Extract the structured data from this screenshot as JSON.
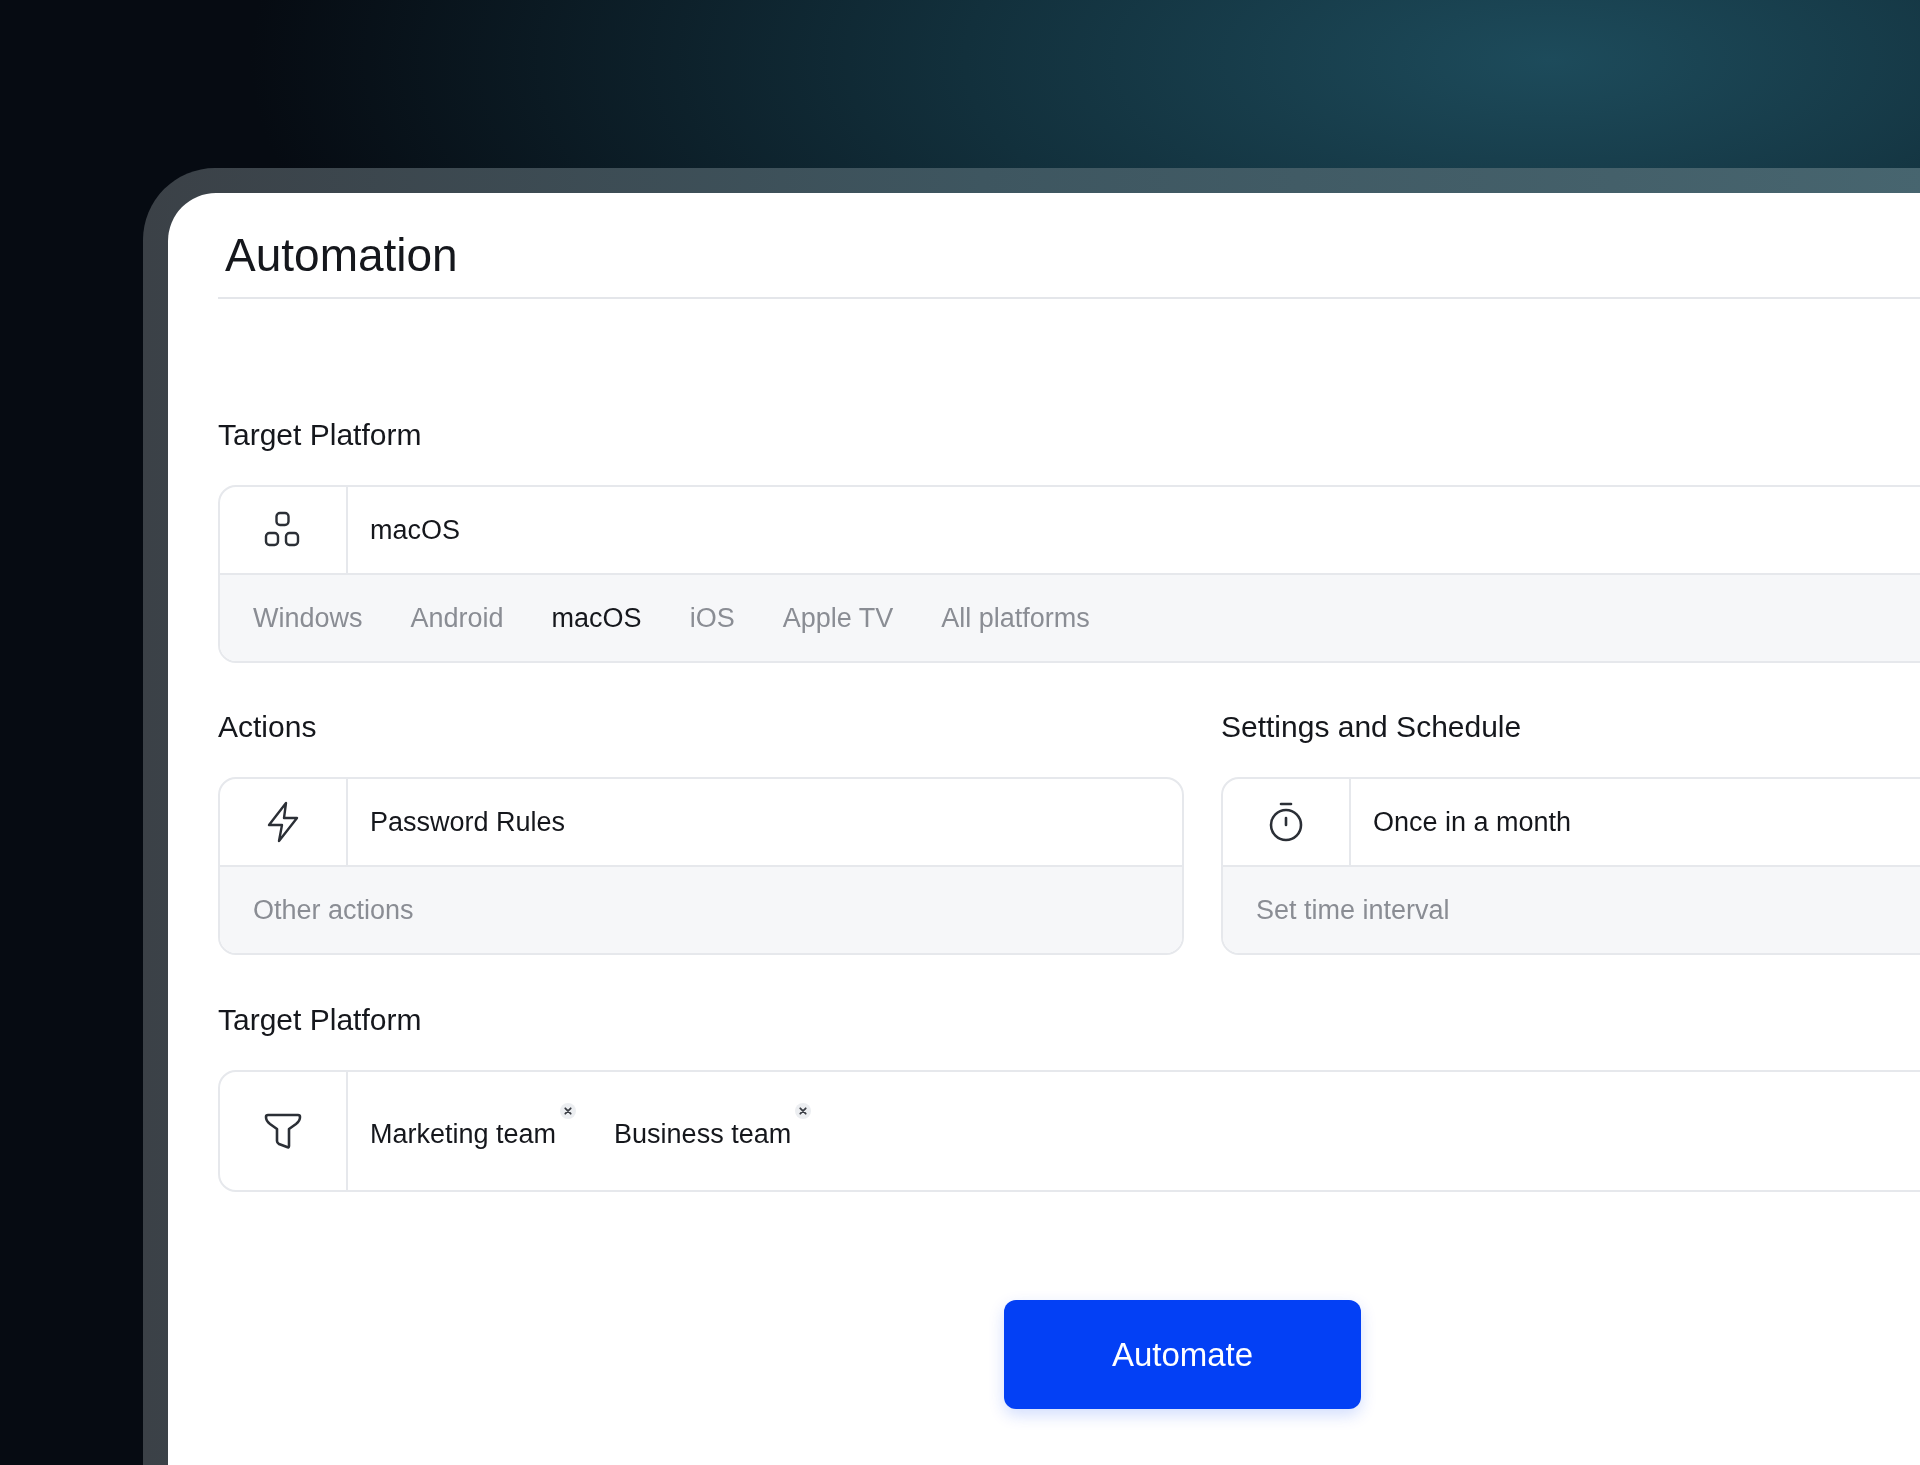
{
  "title": "Automation",
  "platform": {
    "heading": "Target Platform",
    "value": "macOS",
    "options": [
      {
        "label": "Windows",
        "selected": false
      },
      {
        "label": "Android",
        "selected": false
      },
      {
        "label": "macOS",
        "selected": true
      },
      {
        "label": "iOS",
        "selected": false
      },
      {
        "label": "Apple TV",
        "selected": false
      },
      {
        "label": "All platforms",
        "selected": false
      }
    ]
  },
  "actions": {
    "heading": "Actions",
    "value": "Password Rules",
    "footer": "Other actions"
  },
  "schedule": {
    "heading": "Settings and Schedule",
    "value": "Once in a month",
    "footer": "Set time interval"
  },
  "groups": {
    "heading": "Target Platform",
    "tags": [
      "Marketing team",
      "Business team"
    ]
  },
  "button": "Automate"
}
